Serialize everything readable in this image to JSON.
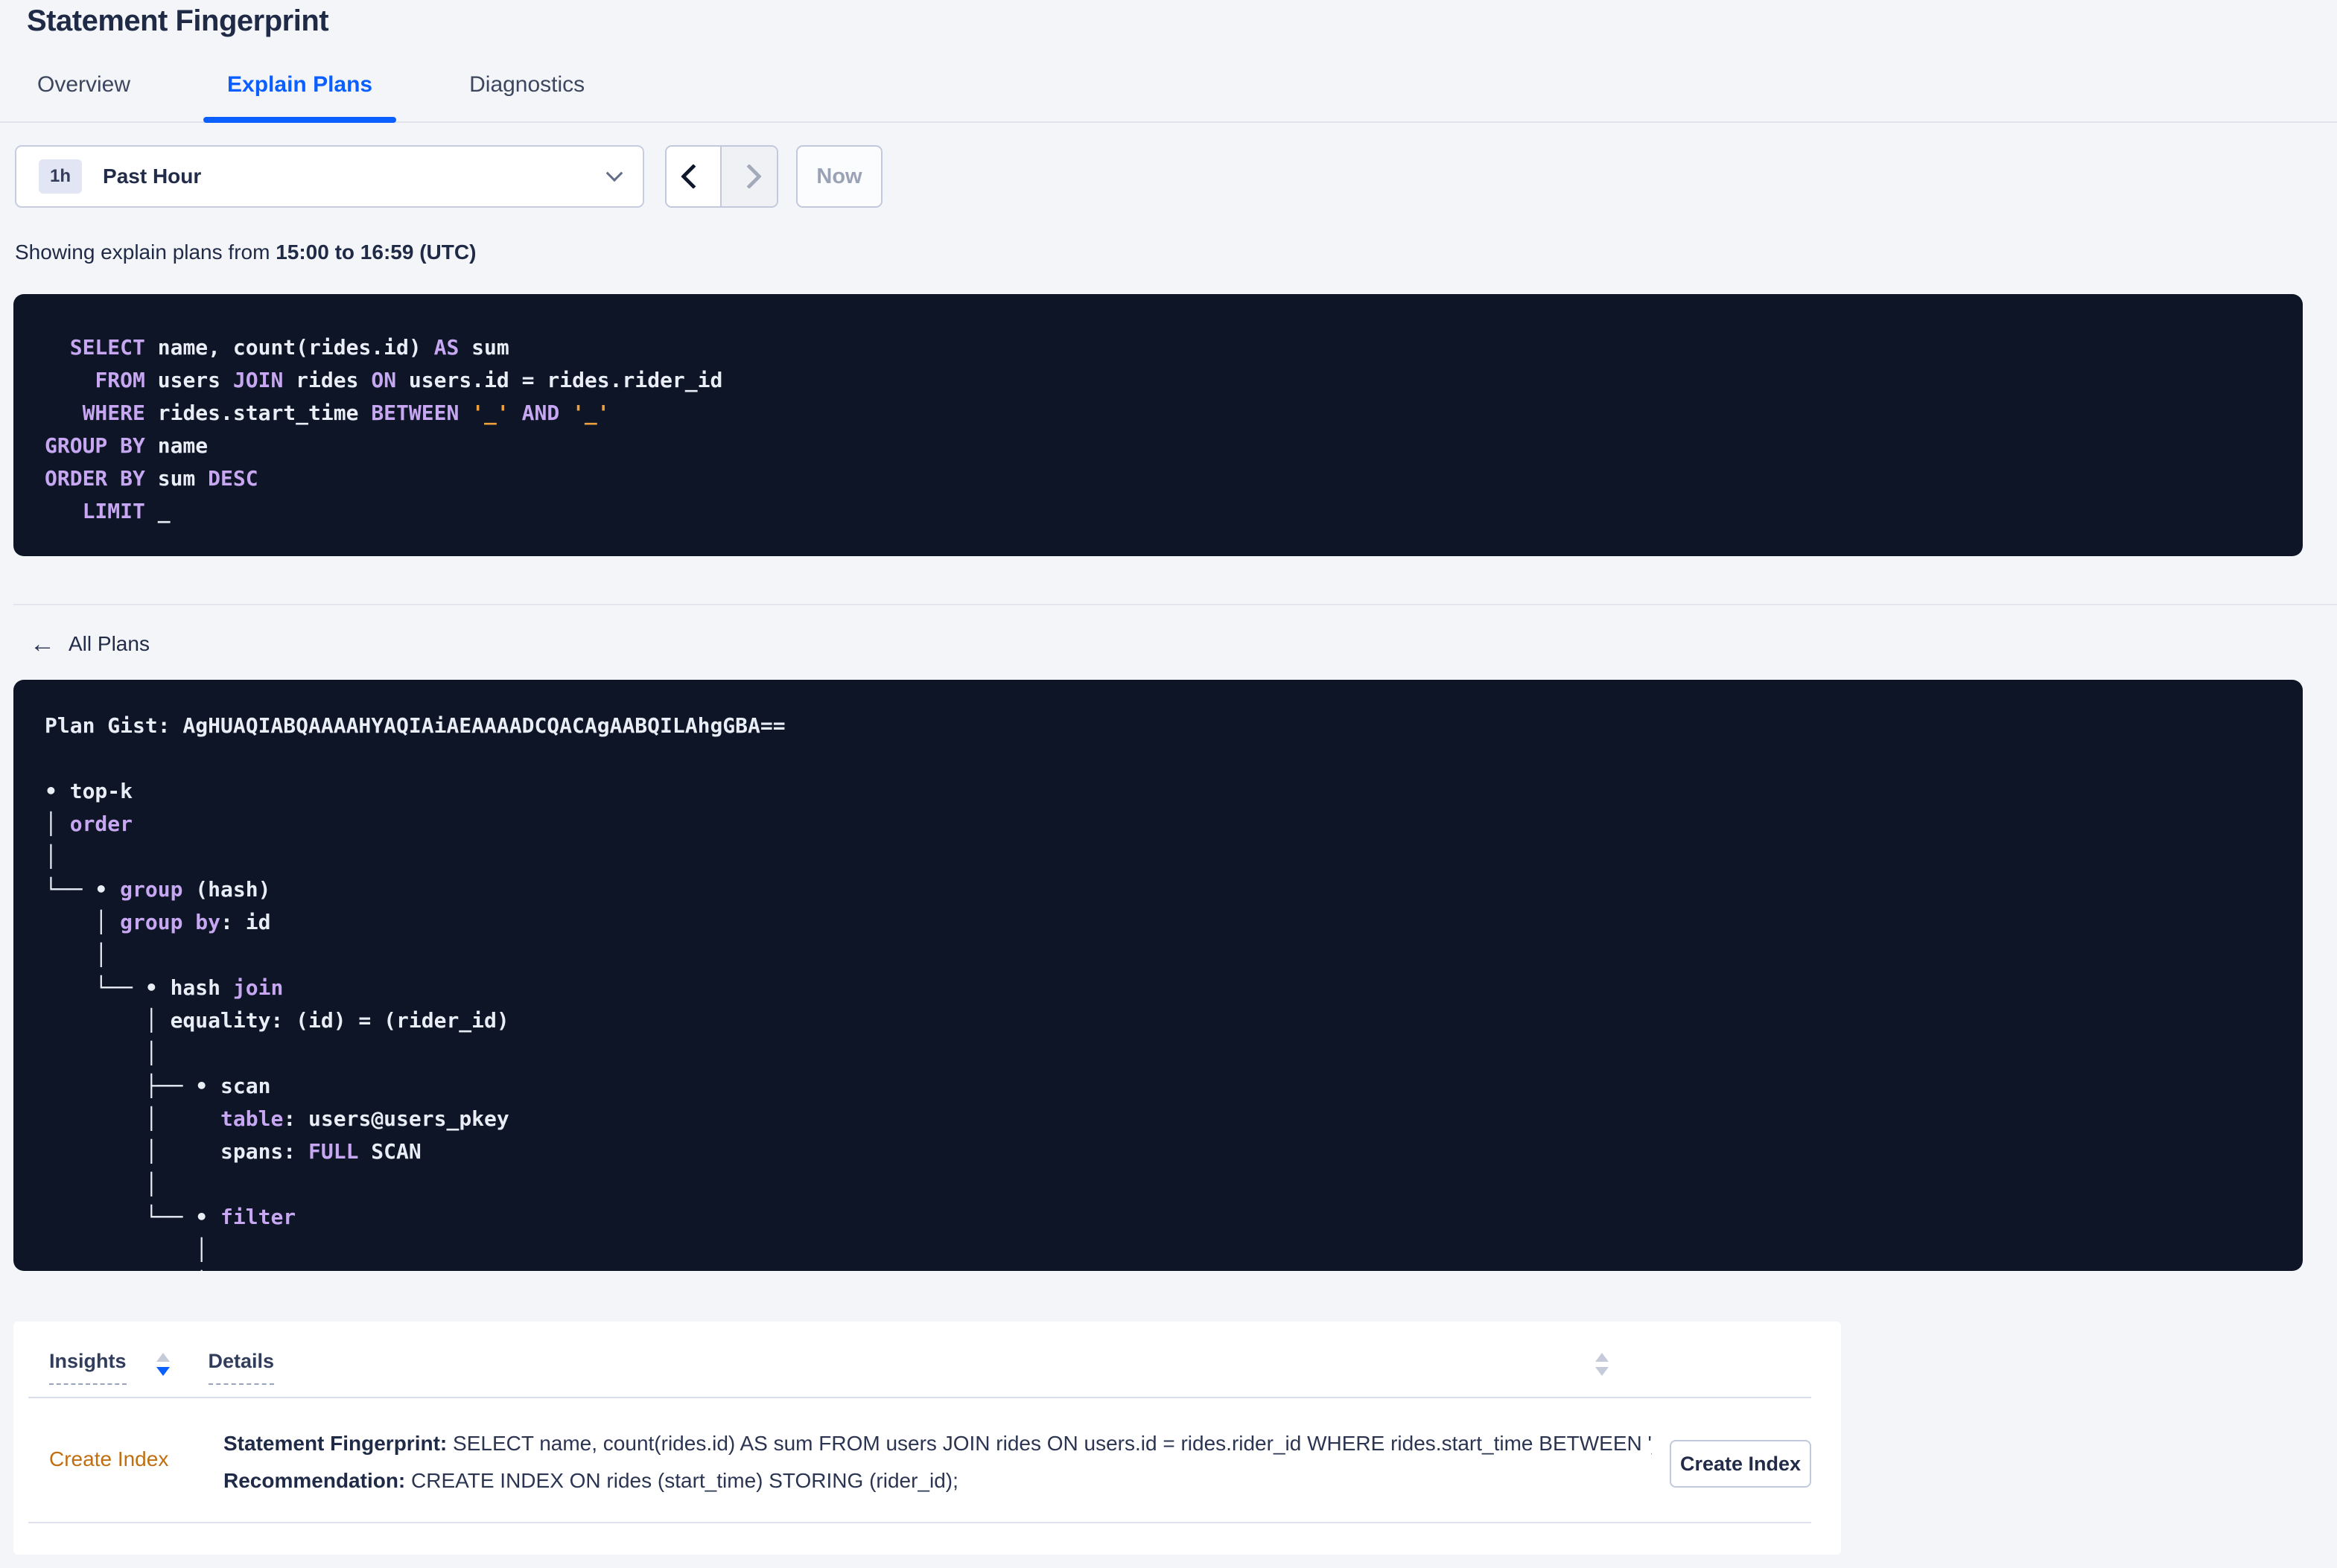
{
  "page": {
    "title": "Statement Fingerprint"
  },
  "tabs": [
    {
      "label": "Overview",
      "active": false
    },
    {
      "label": "Explain Plans",
      "active": true
    },
    {
      "label": "Diagnostics",
      "active": false
    }
  ],
  "time_controls": {
    "interval_badge": "1h",
    "interval_label": "Past Hour",
    "now_label": "Now"
  },
  "showing": {
    "prefix": "Showing explain plans from ",
    "range": "15:00 to 16:59 (UTC)"
  },
  "sql": {
    "lines": [
      {
        "tokens": [
          {
            "t": "  "
          },
          {
            "t": "SELECT",
            "c": "kw"
          },
          {
            "t": " name, count(rides.id) "
          },
          {
            "t": "AS",
            "c": "kw"
          },
          {
            "t": " sum"
          }
        ]
      },
      {
        "tokens": [
          {
            "t": "    "
          },
          {
            "t": "FROM",
            "c": "kw"
          },
          {
            "t": " users "
          },
          {
            "t": "JOIN",
            "c": "kw"
          },
          {
            "t": " rides "
          },
          {
            "t": "ON",
            "c": "kw"
          },
          {
            "t": " users.id = rides.rider_id"
          }
        ]
      },
      {
        "tokens": [
          {
            "t": "   "
          },
          {
            "t": "WHERE",
            "c": "kw"
          },
          {
            "t": " rides.start_time "
          },
          {
            "t": "BETWEEN",
            "c": "kw"
          },
          {
            "t": " "
          },
          {
            "t": "'_'",
            "c": "lit"
          },
          {
            "t": " "
          },
          {
            "t": "AND",
            "c": "kw"
          },
          {
            "t": " "
          },
          {
            "t": "'_'",
            "c": "lit"
          }
        ]
      },
      {
        "tokens": [
          {
            "t": "GROUP BY",
            "c": "kw"
          },
          {
            "t": " name"
          }
        ]
      },
      {
        "tokens": [
          {
            "t": "ORDER BY",
            "c": "kw"
          },
          {
            "t": " sum "
          },
          {
            "t": "DESC",
            "c": "kw"
          }
        ]
      },
      {
        "tokens": [
          {
            "t": "   "
          },
          {
            "t": "LIMIT",
            "c": "kw"
          },
          {
            "t": " _"
          }
        ]
      }
    ]
  },
  "back_link": {
    "label": "All Plans"
  },
  "plan": {
    "lines": [
      {
        "tokens": [
          {
            "t": "Plan Gist: AgHUAQIABQAAAAHYAQIAiAEAAAADCQACAgAABQILAhgGBA=="
          }
        ]
      },
      {
        "tokens": []
      },
      {
        "tokens": [
          {
            "t": "• top-k"
          }
        ]
      },
      {
        "tokens": [
          {
            "t": "│ "
          },
          {
            "t": "order",
            "c": "kw"
          }
        ]
      },
      {
        "tokens": [
          {
            "t": "│"
          }
        ]
      },
      {
        "tokens": [
          {
            "t": "└── • "
          },
          {
            "t": "group",
            "c": "kw"
          },
          {
            "t": " (hash)"
          }
        ]
      },
      {
        "tokens": [
          {
            "t": "    │ "
          },
          {
            "t": "group by",
            "c": "kw"
          },
          {
            "t": ": id"
          }
        ]
      },
      {
        "tokens": [
          {
            "t": "    │"
          }
        ]
      },
      {
        "tokens": [
          {
            "t": "    └── • hash "
          },
          {
            "t": "join",
            "c": "kw"
          }
        ]
      },
      {
        "tokens": [
          {
            "t": "        │ equality: (id) = (rider_id)"
          }
        ]
      },
      {
        "tokens": [
          {
            "t": "        │"
          }
        ]
      },
      {
        "tokens": [
          {
            "t": "        ├── • scan"
          }
        ]
      },
      {
        "tokens": [
          {
            "t": "        │     "
          },
          {
            "t": "table",
            "c": "kw"
          },
          {
            "t": ": users@users_pkey"
          }
        ]
      },
      {
        "tokens": [
          {
            "t": "        │     spans: "
          },
          {
            "t": "FULL",
            "c": "kw"
          },
          {
            "t": " SCAN"
          }
        ]
      },
      {
        "tokens": [
          {
            "t": "        │"
          }
        ]
      },
      {
        "tokens": [
          {
            "t": "        └── • "
          },
          {
            "t": "filter",
            "c": "kw"
          }
        ]
      },
      {
        "tokens": [
          {
            "t": "            │"
          }
        ]
      },
      {
        "tokens": [
          {
            "t": "            │"
          }
        ]
      }
    ]
  },
  "insights_table": {
    "columns": [
      {
        "label": "Insights"
      },
      {
        "label": "Details"
      }
    ],
    "row": {
      "insight_link": "Create Index",
      "fingerprint_label": "Statement Fingerprint:",
      "fingerprint_value": " SELECT name, count(rides.id) AS sum FROM users JOIN rides ON users.id = rides.rider_id WHERE rides.start_time BETWEEN '_…",
      "recommendation_label": "Recommendation:",
      "recommendation_value": " CREATE INDEX ON rides (start_time) STORING (rider_id);",
      "action_button": "Create Index"
    }
  },
  "colors": {
    "accent_blue": "#0b5fff",
    "code_keyword": "#c7a7f2",
    "code_literal": "#efa03d",
    "code_text": "#e9edf6",
    "code_background": "#0d1527",
    "insight_link": "#c06e10",
    "dark_text": "#1f2a46"
  }
}
